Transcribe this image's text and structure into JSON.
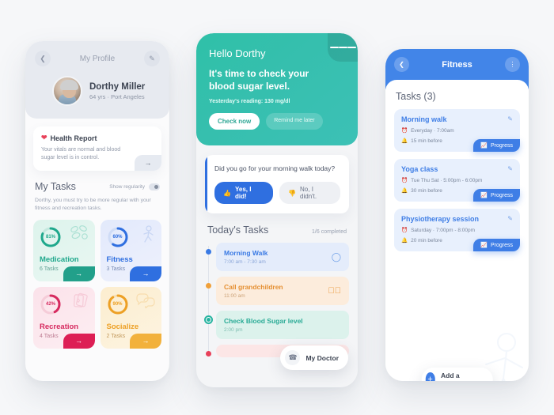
{
  "left_phone": {
    "header": {
      "back_icon": "chevron-left-icon",
      "title": "My Profile",
      "edit_icon": "pencil-icon",
      "user_name": "Dorthy Miller",
      "user_meta": "64 yrs  ·  Port Angeles"
    },
    "health_report": {
      "heart_icon": "heart-pulse-icon",
      "title": "Health Report",
      "text": "Your vitals are normal and blood sugar level is in control.",
      "arrow_icon": "arrow-right-icon"
    },
    "my_tasks": {
      "title": "My Tasks",
      "regularity_label": "Show regularity",
      "subtitle": "Dorthy, you must try to be more regular with your fitness and recreation tasks.",
      "tiles": [
        {
          "name": "Medication",
          "percent": "81%",
          "count": "6 Tasks",
          "art_icon": "pills-icon",
          "accent": "#22a08a"
        },
        {
          "name": "Fitness",
          "percent": "60%",
          "count": "3 Tasks",
          "art_icon": "walking-person-icon",
          "accent": "#2f6fe0"
        },
        {
          "name": "Recreation",
          "percent": "42%",
          "count": "4 Tasks",
          "art_icon": "playing-cards-icon",
          "accent": "#dd1f55"
        },
        {
          "name": "Socialize",
          "percent": "90%",
          "count": "2 Tasks",
          "art_icon": "chat-bubbles-icon",
          "accent": "#f2b13c"
        }
      ]
    }
  },
  "mid_phone": {
    "hero": {
      "menu_icon": "hamburger-menu-icon",
      "greeting": "Hello Dorthy",
      "headline": "It's time to check your blood sugar level.",
      "reading": "Yesterday's reading: 130 mg/dl",
      "primary_button": "Check now",
      "secondary_button": "Remind me later"
    },
    "question_card": {
      "text": "Did you go for your morning walk today?",
      "yes_label": "Yes, I did!",
      "yes_icon": "thumbs-up-icon",
      "no_label": "No, I didn't.",
      "no_icon": "thumbs-down-icon"
    },
    "todays_tasks": {
      "title": "Today's Tasks",
      "completed": "1/6 completed",
      "items": [
        {
          "name": "Morning Walk",
          "time": "7:00 am - 7:30 am",
          "state_icon": "circle-empty-icon",
          "dot": "#3a7ae4"
        },
        {
          "name": "Call grandchildren",
          "time": "11:00 am",
          "state_icon": "check-circle-icon",
          "dot": "#f0a03a"
        },
        {
          "name": "Check Blood Sugar level",
          "time": "2:00 pm",
          "state_icon": "",
          "dot": "#27b3a0"
        },
        {
          "name": "",
          "time": "",
          "state_icon": "",
          "dot": "#e8415a"
        }
      ]
    },
    "doctor_pill": {
      "label": "My Doctor",
      "icon": "phone-call-icon"
    }
  },
  "right_phone": {
    "header": {
      "back_icon": "chevron-left-icon",
      "title": "Fitness",
      "more_icon": "more-vertical-icon"
    },
    "tasks_heading": "Tasks (3)",
    "tasks": [
      {
        "name": "Morning walk",
        "schedule": "Everyday  ·  7:00am",
        "reminder": "15 min before",
        "edit_icon": "pencil-icon",
        "clock_icon": "clock-icon",
        "bell_icon": "bell-icon",
        "progress_label": "Progress",
        "progress_icon": "chart-line-icon"
      },
      {
        "name": "Yoga class",
        "schedule": "Tue Thu Sat  ·  5:00pm - 6:00pm",
        "reminder": "30 min before",
        "edit_icon": "pencil-icon",
        "clock_icon": "clock-icon",
        "bell_icon": "bell-icon",
        "progress_label": "Progress",
        "progress_icon": "chart-line-icon"
      },
      {
        "name": "Physiotherapy session",
        "schedule": "Saturday  ·  7:00pm - 8:00pm",
        "reminder": "20 min before",
        "edit_icon": "pencil-icon",
        "clock_icon": "clock-icon",
        "bell_icon": "bell-icon",
        "progress_label": "Progress",
        "progress_icon": "chart-line-icon"
      }
    ],
    "add_button": {
      "label": "Add a fitness task",
      "icon": "plus-icon"
    }
  }
}
